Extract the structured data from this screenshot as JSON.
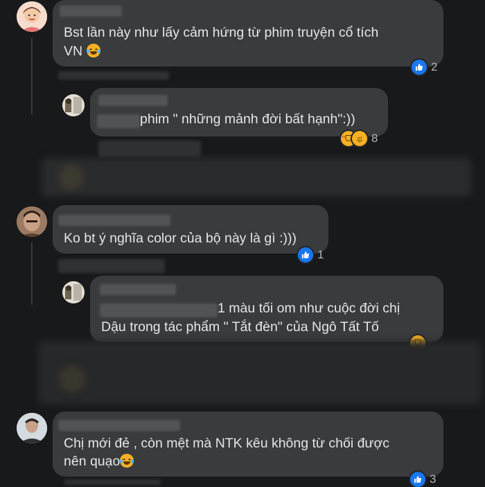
{
  "comments": [
    {
      "text_lines": [
        "Bst lần này như lấy cảm hứng từ phim truyện cổ tích",
        "VN"
      ],
      "reaction_count": "2",
      "reaction_icons": [
        "like-icon"
      ]
    },
    {
      "text_lines": [
        "phim \" những mảnh đời bất hạnh\":))"
      ],
      "reaction_count": "8",
      "reaction_icons": [
        "haha-icon",
        "sad-icon"
      ]
    },
    {
      "text_lines": [
        "Ko bt ý nghĩa color của bộ này là gì :)))"
      ],
      "reaction_count": "1",
      "reaction_icons": [
        "like-icon"
      ]
    },
    {
      "text_lines": [
        "1 màu tối om như cuộc đời chị",
        "Dậu trong tác phẩm \" Tắt đèn\" của Ngô Tất Tố"
      ],
      "reaction_icons": [
        "haha-icon"
      ]
    },
    {
      "text_lines": [
        "Chị mới đẻ , còn mệt mà NTK kêu không từ chối được",
        "nên quạo"
      ],
      "reaction_count": "3",
      "reaction_icons": [
        "like-icon"
      ]
    }
  ],
  "colors": {
    "background": "#18191a",
    "bubble": "#3a3b3c",
    "text": "#e4e6eb",
    "like_blue": "#1877f2",
    "emoji_yellow": "#f7b125"
  }
}
